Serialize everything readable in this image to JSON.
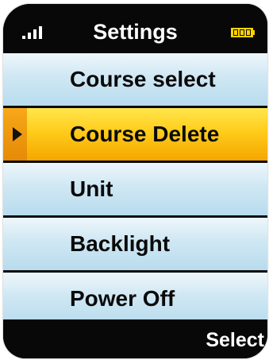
{
  "header": {
    "title": "Settings",
    "signal_icon": "signal-bars-icon",
    "battery_icon": "battery-icon",
    "battery_color": "#ffd400"
  },
  "menu": {
    "items": [
      {
        "label": "Course select",
        "selected": false
      },
      {
        "label": "Course Delete",
        "selected": true
      },
      {
        "label": "Unit",
        "selected": false
      },
      {
        "label": "Backlight",
        "selected": false
      },
      {
        "label": "Power Off",
        "selected": false
      }
    ],
    "selection_icon": "play-arrow-icon"
  },
  "footer": {
    "softkey_label": "Select"
  },
  "colors": {
    "item_background": "#cfe7f3",
    "selected_background": "#ffcc1a",
    "selected_marker": "#e58a07",
    "frame": "#0b0b0b"
  }
}
